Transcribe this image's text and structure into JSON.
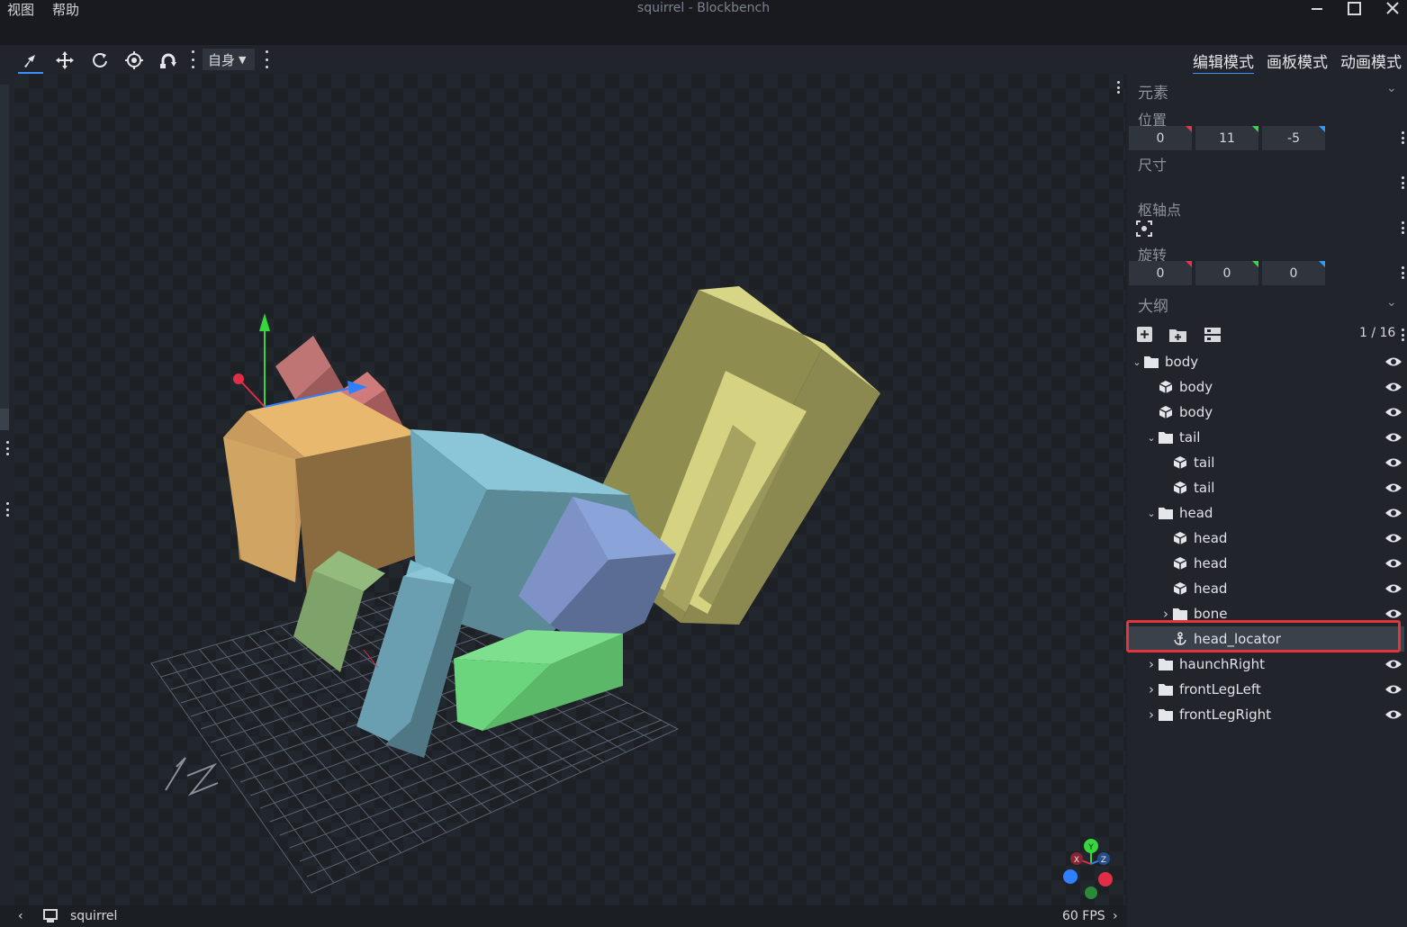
{
  "app": {
    "title": "squirrel - Blockbench",
    "menu": [
      "视图",
      "帮助"
    ]
  },
  "toolbar": {
    "tools": [
      "move-tool",
      "translate-tool",
      "rotate-tool",
      "pivot-tool",
      "vertex-snap-tool"
    ],
    "transform_space": "自身",
    "modes": [
      "编辑模式",
      "画板模式",
      "动画模式"
    ],
    "active_mode": "编辑模式"
  },
  "element_panel": {
    "title": "元素",
    "position_label": "位置",
    "position": [
      "0",
      "11",
      "-5"
    ],
    "size_label": "尺寸",
    "pivot_label": "枢轴点",
    "rotation_label": "旋转",
    "rotation": [
      "0",
      "0",
      "0"
    ]
  },
  "outliner": {
    "title": "大纲",
    "count": "1 / 16",
    "items": [
      {
        "name": "body",
        "type": "group",
        "depth": 0,
        "expanded": true
      },
      {
        "name": "body",
        "type": "cube",
        "depth": 1
      },
      {
        "name": "body",
        "type": "cube",
        "depth": 1
      },
      {
        "name": "tail",
        "type": "group",
        "depth": 1,
        "expanded": true
      },
      {
        "name": "tail",
        "type": "cube",
        "depth": 2
      },
      {
        "name": "tail",
        "type": "cube",
        "depth": 2
      },
      {
        "name": "head",
        "type": "group",
        "depth": 1,
        "expanded": true
      },
      {
        "name": "head",
        "type": "cube",
        "depth": 2
      },
      {
        "name": "head",
        "type": "cube",
        "depth": 2
      },
      {
        "name": "head",
        "type": "cube",
        "depth": 2
      },
      {
        "name": "bone",
        "type": "group",
        "depth": 2,
        "expanded": false
      },
      {
        "name": "head_locator",
        "type": "locator",
        "depth": 2,
        "selected": true
      },
      {
        "name": "haunchRight",
        "type": "group",
        "depth": 1,
        "expanded": false
      },
      {
        "name": "frontLegLeft",
        "type": "group",
        "depth": 1,
        "expanded": false
      },
      {
        "name": "frontLegRight",
        "type": "group",
        "depth": 1,
        "expanded": false
      }
    ]
  },
  "statusbar": {
    "model_name": "squirrel",
    "fps": "60 FPS"
  },
  "gizmo_axes": {
    "y": "Y",
    "x": "X",
    "z": "Z"
  },
  "colors": {
    "accent": "#3e90ff",
    "highlight_border": "#e4353c",
    "axis_x": "#e5354a",
    "axis_y": "#3ed44a",
    "axis_z": "#2f9bff"
  }
}
